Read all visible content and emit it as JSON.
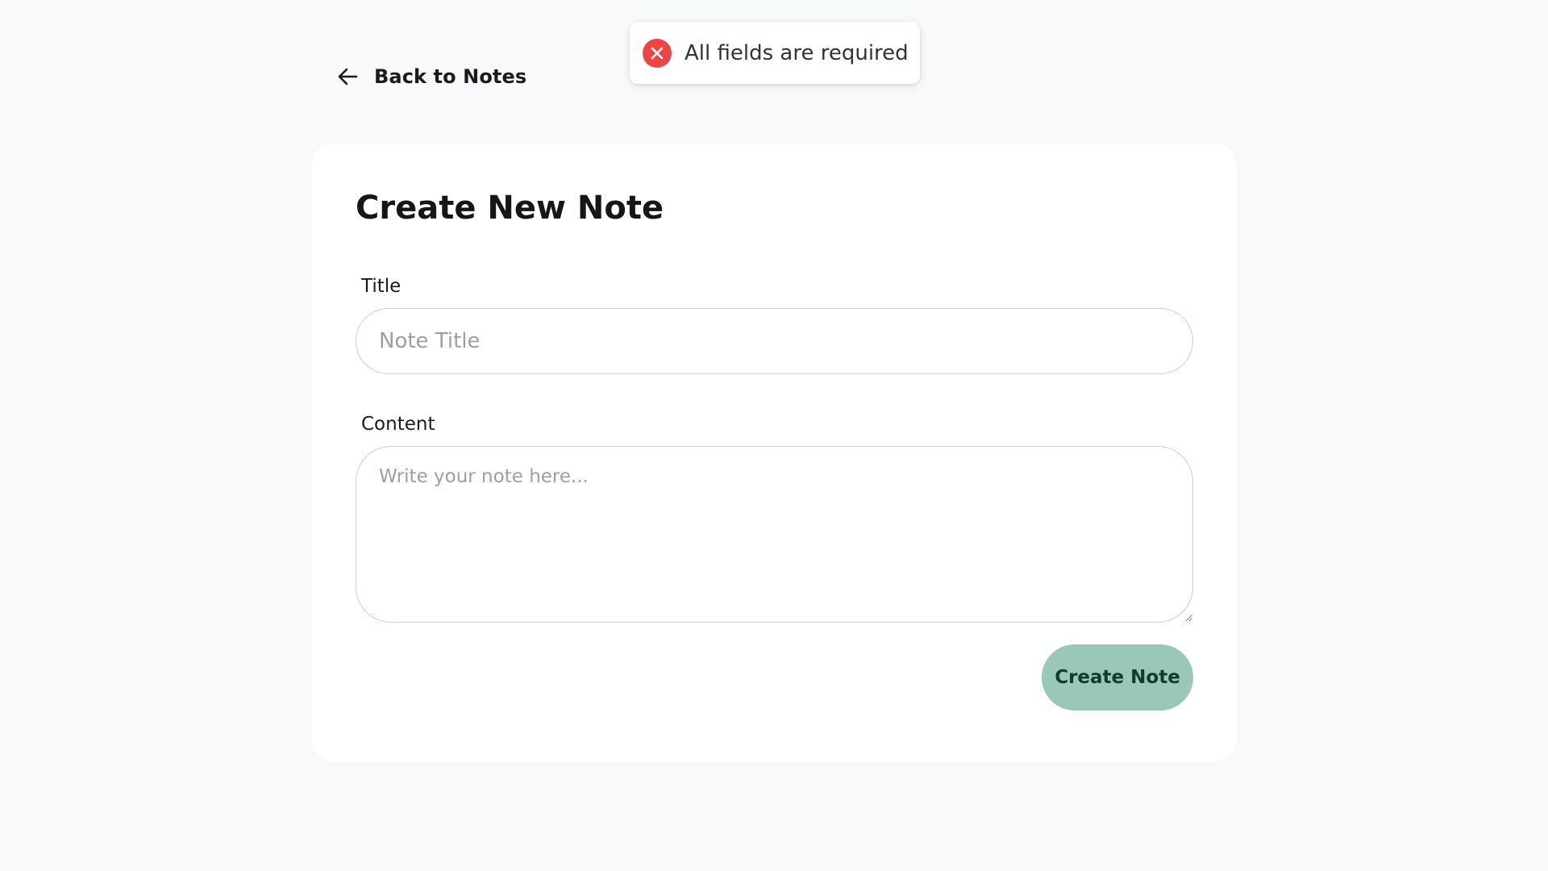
{
  "nav": {
    "back_label": "Back to Notes",
    "back_icon": "arrow-left-icon"
  },
  "toast": {
    "message": "All fields are required",
    "icon": "error-x-icon",
    "icon_color": "#ef4444"
  },
  "form": {
    "heading": "Create New Note",
    "title_label": "Title",
    "title_placeholder": "Note Title",
    "title_value": "",
    "content_label": "Content",
    "content_placeholder": "Write your note here...",
    "content_value": "",
    "submit_label": "Create Note",
    "submit_color": "#99c9b6"
  },
  "colors": {
    "background": "#f8f9fa",
    "card": "#ffffff",
    "error": "#ef4444"
  }
}
